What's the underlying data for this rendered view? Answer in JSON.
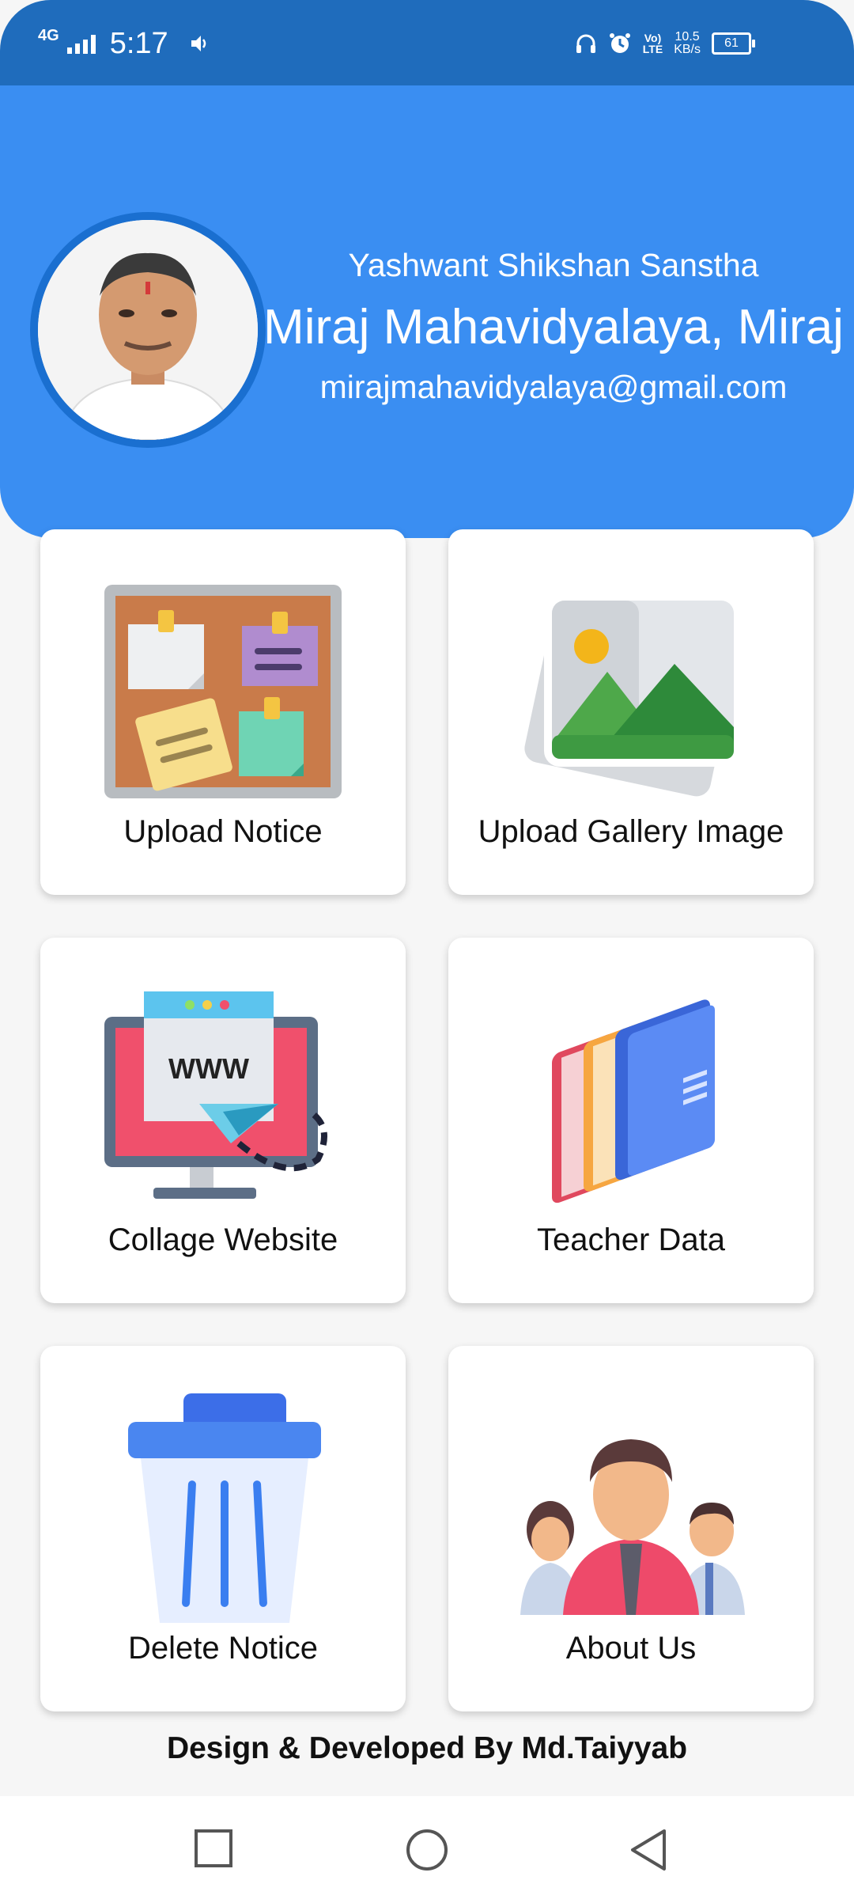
{
  "status_bar": {
    "network": "4G",
    "time": "5:17",
    "speed_value": "10.5",
    "speed_unit": "KB/s",
    "volte_top": "Vo)",
    "volte_bottom": "LTE",
    "battery": "61",
    "icons": [
      "signal-icon",
      "volume-icon",
      "headphones-icon",
      "alarm-icon"
    ]
  },
  "header": {
    "org": "Yashwant Shikshan Sanstha",
    "college": "Miraj Mahavidyalaya, Miraj",
    "email": "mirajmahavidyalaya@gmail.com"
  },
  "cards": [
    {
      "label": "Upload Notice",
      "icon": "notice-board-icon"
    },
    {
      "label": "Upload Gallery Image",
      "icon": "gallery-image-icon"
    },
    {
      "label": "Collage Website",
      "icon": "website-icon"
    },
    {
      "label": "Teacher Data",
      "icon": "folders-icon"
    },
    {
      "label": "Delete Notice",
      "icon": "trash-icon"
    },
    {
      "label": "About Us",
      "icon": "people-icon"
    }
  ],
  "footer": {
    "credit": "Design & Developed By Md.Taiyyab"
  },
  "navbar": {
    "buttons": [
      "recent-apps-button",
      "home-button",
      "back-button"
    ]
  },
  "colors": {
    "header": "#3a8ef2",
    "status_bar": "#1f6cbc"
  }
}
